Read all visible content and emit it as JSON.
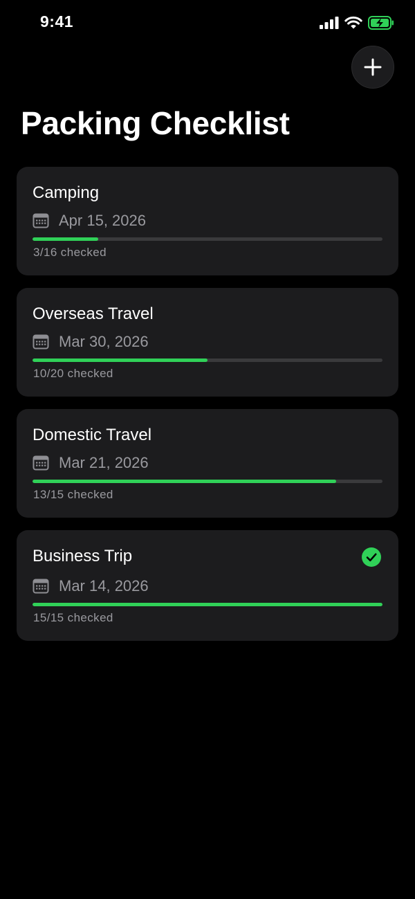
{
  "status_bar": {
    "time": "9:41"
  },
  "header": {
    "title": "Packing Checklist",
    "add_icon": "plus-icon"
  },
  "colors": {
    "background": "#000000",
    "card": "#1c1c1e",
    "accent_green": "#30d158",
    "track": "#3a3a3c",
    "secondary_text": "#9a9a9f"
  },
  "checklists": [
    {
      "name": "Camping",
      "date": "Apr 15, 2026",
      "checked": 3,
      "total": 16,
      "count_text": "3/16 checked",
      "complete": false
    },
    {
      "name": "Overseas Travel",
      "date": "Mar 30, 2026",
      "checked": 10,
      "total": 20,
      "count_text": "10/20 checked",
      "complete": false
    },
    {
      "name": "Domestic Travel",
      "date": "Mar 21, 2026",
      "checked": 13,
      "total": 15,
      "count_text": "13/15 checked",
      "complete": false
    },
    {
      "name": "Business Trip",
      "date": "Mar 14, 2026",
      "checked": 15,
      "total": 15,
      "count_text": "15/15 checked",
      "complete": true
    }
  ]
}
